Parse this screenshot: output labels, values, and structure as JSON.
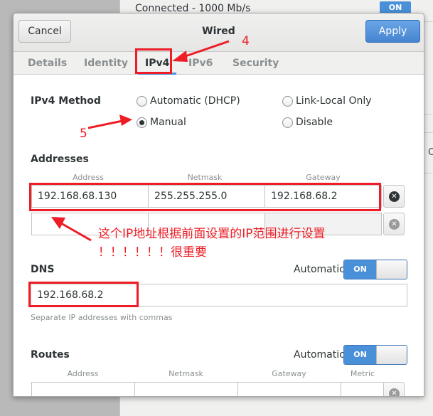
{
  "background": {
    "connected_text": "Connected - 1000 Mb/s",
    "on_label": "ON",
    "edge_text": "C"
  },
  "dialog": {
    "title": "Wired",
    "cancel_label": "Cancel",
    "apply_label": "Apply"
  },
  "tabs": [
    {
      "label": "Details",
      "active": false
    },
    {
      "label": "Identity",
      "active": false
    },
    {
      "label": "IPv4",
      "active": true
    },
    {
      "label": "IPv6",
      "active": false
    },
    {
      "label": "Security",
      "active": false
    }
  ],
  "ipv4_method": {
    "label": "IPv4 Method",
    "options": [
      {
        "label": "Automatic (DHCP)",
        "checked": false
      },
      {
        "label": "Link-Local Only",
        "checked": false
      },
      {
        "label": "Manual",
        "checked": true
      },
      {
        "label": "Disable",
        "checked": false
      }
    ]
  },
  "addresses": {
    "label": "Addresses",
    "columns": [
      "Address",
      "Netmask",
      "Gateway"
    ],
    "rows": [
      {
        "address": "192.168.68.130",
        "netmask": "255.255.255.0",
        "gateway": "192.168.68.2"
      },
      {
        "address": "",
        "netmask": "",
        "gateway": ""
      }
    ]
  },
  "dns": {
    "label": "DNS",
    "automatic_label": "Automatic",
    "switch_label": "ON",
    "value": "192.168.68.2",
    "hint": "Separate IP addresses with commas"
  },
  "routes": {
    "label": "Routes",
    "automatic_label": "Automatic",
    "switch_label": "ON",
    "columns": [
      "Address",
      "Netmask",
      "Gateway",
      "Metric"
    ]
  },
  "annotations": {
    "step4": "4",
    "step5": "5",
    "note_line1": "这个IP地址根据前面设置的IP范围进行设置",
    "note_line2": "！！！！！！很重要",
    "color": "#ee1c25"
  },
  "colors": {
    "accent": "#4a90d9",
    "annotation": "#ee1c25"
  }
}
